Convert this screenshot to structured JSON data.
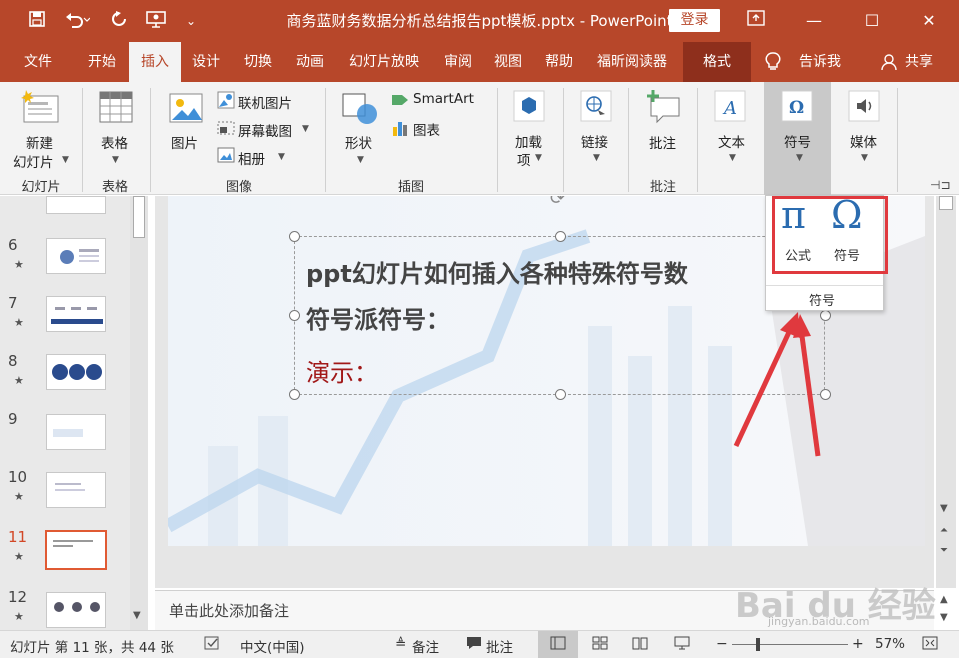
{
  "titlebar": {
    "doc_title": "商务蓝财务数据分析总结报告ppt模板.pptx  -  PowerPoint",
    "login": "登录",
    "icons": [
      "save-icon",
      "undo-icon",
      "redo-icon",
      "present-icon",
      "customize-icon",
      "ribbon-display-icon",
      "minimize-icon",
      "maximize-icon",
      "close-icon"
    ],
    "colors": {
      "brand": "#b7472a"
    }
  },
  "tabs": {
    "items": [
      {
        "label": "文件"
      },
      {
        "label": "开始"
      },
      {
        "label": "插入"
      },
      {
        "label": "设计"
      },
      {
        "label": "切换"
      },
      {
        "label": "动画"
      },
      {
        "label": "幻灯片放映"
      },
      {
        "label": "审阅"
      },
      {
        "label": "视图"
      },
      {
        "label": "帮助"
      },
      {
        "label": "福昕阅读器"
      },
      {
        "label": "格式"
      },
      {
        "label": "告诉我"
      },
      {
        "label": "共享"
      }
    ],
    "active": "插入"
  },
  "ribbon": {
    "groups": {
      "slides": "幻灯片",
      "tables": "表格",
      "images": "图像",
      "illustrations": "插图",
      "comments": "批注"
    },
    "buttons": {
      "new_slide_1": "新建",
      "new_slide_2": "幻灯片",
      "table": "表格",
      "picture": "图片",
      "online_pictures": "联机图片",
      "screenshot": "屏幕截图",
      "album": "相册",
      "shapes": "形状",
      "smartart": "SmartArt",
      "chart": "图表",
      "addins_1": "加载",
      "addins_2": "项",
      "link": "链接",
      "comment": "批注",
      "text": "文本",
      "symbols": "符号",
      "media": "媒体"
    }
  },
  "thumbnails": [
    {
      "num": "6"
    },
    {
      "num": "7"
    },
    {
      "num": "8"
    },
    {
      "num": "9"
    },
    {
      "num": "10"
    },
    {
      "num": "11"
    },
    {
      "num": "12"
    }
  ],
  "slide": {
    "line1": "ppt幻灯片如何插入各种特殊符号数",
    "line2": "符号派符号：",
    "demo": "演示："
  },
  "popup": {
    "equation_symbol": "π",
    "equation_label": "公式",
    "symbol_symbol": "Ω",
    "symbol_label": "符号",
    "group_label": "符号"
  },
  "notes": {
    "placeholder": "单击此处添加备注"
  },
  "statusbar": {
    "slide_info": "幻灯片 第 11 张，共 44 张",
    "language": "中文(中国)",
    "notes": "备注",
    "comments": "批注",
    "zoom": "57%"
  },
  "watermark": {
    "brand": "Bai du 经验",
    "url": "jingyan.baidu.com"
  }
}
